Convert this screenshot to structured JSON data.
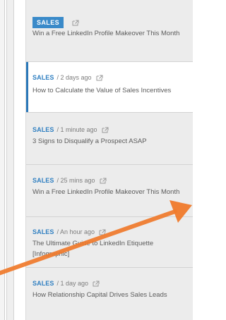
{
  "feed": {
    "items": [
      {
        "category": "SALES",
        "time": "",
        "title": "Win a Free LinkedIn Profile Makeover This Month",
        "icon": "share-icon"
      },
      {
        "category": "SALES",
        "time": "/ 2 days ago",
        "title": "How to Calculate the Value of Sales Incentives",
        "icon": "share-icon"
      },
      {
        "category": "SALES",
        "time": "/ 1 minute ago",
        "title": "3 Signs to Disqualify a Prospect ASAP",
        "icon": "share-icon"
      },
      {
        "category": "SALES",
        "time": "/ 25 mins ago",
        "title": "Win a Free LinkedIn Profile Makeover This Month",
        "icon": "share-icon"
      },
      {
        "category": "SALES",
        "time": "/ An hour ago",
        "title": "The Ultimate Guide to LinkedIn Etiquette [Infographic]",
        "icon": "share-icon"
      },
      {
        "category": "SALES",
        "time": "/ 1 day ago",
        "title": "How Relationship Capital Drives Sales Leads",
        "icon": "share-icon"
      }
    ]
  },
  "annotation": {
    "color": "#f07a2b",
    "icon": "arrow-annotation"
  },
  "colors": {
    "accent": "#2f7fc1",
    "active_border": "#2a77b8"
  }
}
